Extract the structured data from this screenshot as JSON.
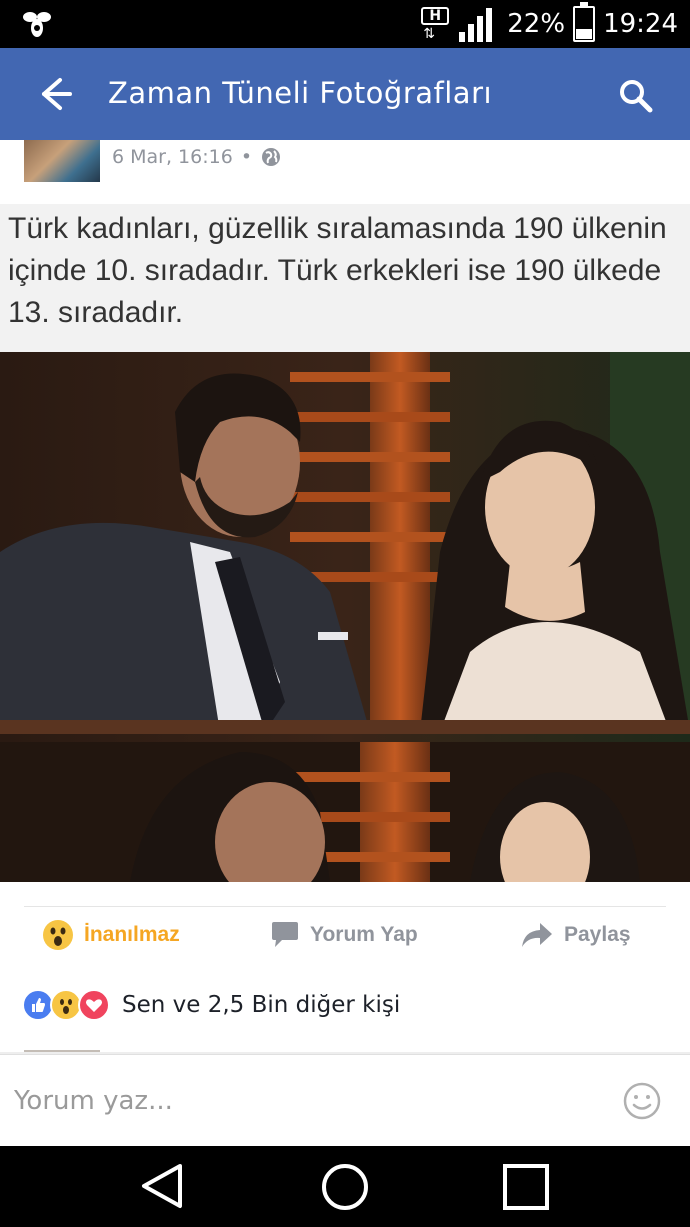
{
  "status_bar": {
    "app_icon": "bee-icon",
    "network_type": "H",
    "battery_percent": "22%",
    "battery_level": 0.22,
    "time": "19:24"
  },
  "app_bar": {
    "title": "Zaman Tüneli Fotoğrafları",
    "back_icon": "arrow-left-icon",
    "search_icon": "search-icon",
    "color": "#4267b2"
  },
  "post": {
    "timestamp": "6 Mar, 16:16",
    "separator": "•",
    "privacy_icon": "globe-icon",
    "image_caption": "Türk kadınları, güzellik sıralamasında 190 ülkenin içinde 10. sıradadır. Türk erkekleri ise 190 ülkede 13. sıradadır."
  },
  "actions": {
    "react_label": "İnanılmaz",
    "react_icon": "wow-emoji-icon",
    "react_color": "#f5a623",
    "comment_label": "Yorum Yap",
    "comment_icon": "comment-icon",
    "share_label": "Paylaş",
    "share_icon": "share-arrow-icon"
  },
  "reactions": {
    "icons": [
      "like-icon",
      "wow-icon",
      "love-icon"
    ],
    "summary": "Sen ve 2,5 Bin diğer kişi"
  },
  "comment_box": {
    "placeholder": "Yorum yaz...",
    "emoji_icon": "smiley-icon"
  },
  "nav_bar": {
    "back_icon": "triangle-back-icon",
    "home_icon": "circle-home-icon",
    "recent_icon": "square-recents-icon"
  }
}
